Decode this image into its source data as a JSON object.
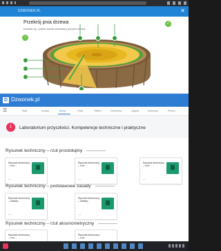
{
  "top_window": {
    "app_bar_text": "DZWONEK.PL",
    "lesson_title": "Przekrój pnia drzewa",
    "lesson_description": "Dowiedz się, z jakich warstw zbudowany jest pień drzewa.",
    "close_icon": "close-icon",
    "nav_icon": "arrow-left-icon",
    "status_icon": "check-icon"
  },
  "site": {
    "brand": "Dzwonek.pl",
    "logo_letter": "D",
    "menu_icon": "hamburger-icon",
    "nav_items": [
      "Start",
      "Szukaj",
      "Kursy",
      "Testy",
      "Tablice",
      "Ćwiczenia",
      "Zajęcia",
      "Konkursy",
      "Pomoc"
    ],
    "active_nav_index": 2,
    "colors": {
      "header": "#2f7dd3",
      "accent": "#e8335a",
      "tile": "#1c9a6d",
      "tree_ring_inner": "#e8b820",
      "bark": "#8a6a45"
    }
  },
  "course": {
    "number": "1",
    "title": "Laboratorium przyszłości. Kompetencje techniczne i praktyczne",
    "sections": [
      {
        "title": "Rysunek techniczny – rzut prostokątny",
        "cards": [
          {
            "title": "Rysunek techniczny – rzut...",
            "dots": "..."
          },
          {
            "title": "Rysunek techniczny – rzut...",
            "dots": "..."
          },
          {
            "title": "Rysunek techniczny – rzut...",
            "dots": "..."
          }
        ]
      },
      {
        "title": "Rysunek techniczny – podstawowe zasady",
        "cards": [
          {
            "title": "Rysunek techniczny – zasady...",
            "dots": "..."
          },
          {
            "title": "Rysunek techniczny – zasady...",
            "dots": "..."
          }
        ]
      },
      {
        "title": "Rysunek techniczny – rzut aksonometryczny",
        "cards": [
          {
            "title": "Rysunek techniczny – rzut...",
            "dots": ""
          },
          {
            "title": "Rysunek techniczny – rzut...",
            "dots": ""
          }
        ]
      }
    ]
  }
}
